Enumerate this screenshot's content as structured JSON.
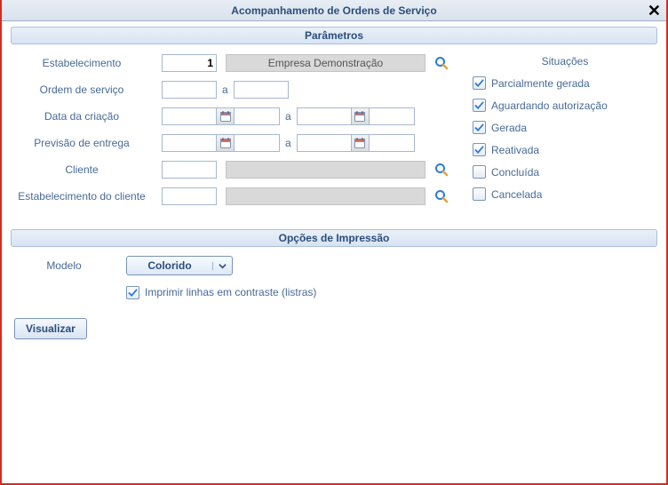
{
  "title": "Acompanhamento de Ordens de Serviço",
  "sections": {
    "params": "Parâmetros",
    "print": "Opções de Impressão"
  },
  "labels": {
    "estab": "Estabelecimento",
    "ordem": "Ordem de serviço",
    "data_criacao": "Data da criação",
    "previsao": "Previsão de entrega",
    "cliente": "Cliente",
    "estab_cliente": "Estabelecimento do cliente",
    "a": "a",
    "situacoes": "Situações",
    "modelo": "Modelo",
    "contraste": "Imprimir linhas em contraste (listras)"
  },
  "values": {
    "estab_code": "1",
    "estab_name": "Empresa Demonstração",
    "ordem_from": "",
    "ordem_to": "",
    "data_from": "",
    "data_from_time": "",
    "data_to": "",
    "data_to_time": "",
    "prev_from": "",
    "prev_from_time": "",
    "prev_to": "",
    "prev_to_time": "",
    "cliente_code": "",
    "cliente_name": "",
    "estab_cli_code": "",
    "estab_cli_name": "",
    "modelo": "Colorido",
    "contraste_checked": true
  },
  "situacoes": [
    {
      "label": "Parcialmente gerada",
      "checked": true
    },
    {
      "label": "Aguardando autorização",
      "checked": true
    },
    {
      "label": "Gerada",
      "checked": true
    },
    {
      "label": "Reativada",
      "checked": true
    },
    {
      "label": "Concluída",
      "checked": false
    },
    {
      "label": "Cancelada",
      "checked": false
    }
  ],
  "buttons": {
    "visualizar": "Visualizar"
  }
}
